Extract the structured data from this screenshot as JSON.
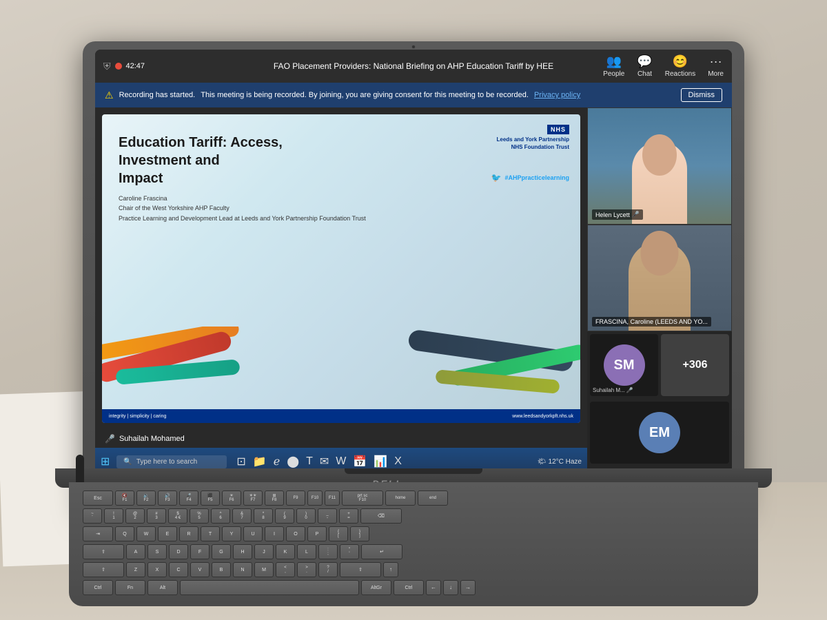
{
  "meeting": {
    "title": "FAO Placement Providers: National Briefing on AHP Education Tariff by HEE",
    "timer": "42:47",
    "recording_message": "Recording has started.",
    "recording_detail": "This meeting is being recorded. By joining, you are giving consent for this meeting to be recorded.",
    "privacy_link": "Privacy policy",
    "dismiss_label": "Dismiss"
  },
  "toolbar": {
    "people_label": "People",
    "chat_label": "Chat",
    "reactions_label": "Reactions",
    "more_label": "More"
  },
  "slide": {
    "nhs_logo": "NHS",
    "trust_name": "Leeds and York Partnership",
    "trust_sub": "NHS Foundation Trust",
    "title_line1": "Education Tariff: Access, Investment and",
    "title_line2": "Impact",
    "twitter_handle": "#AHPpracticelearning",
    "presenter_name": "Caroline Frascina",
    "presenter_role1": "Chair of the West Yorkshire AHP Faculty",
    "presenter_role2": "Practice Learning and Development Lead at Leeds and York Partnership Foundation Trust",
    "footer_text": "integrity  |  simplicity  |  caring",
    "footer_url": "www.leedsandyorkpft.nhs.uk"
  },
  "participants": {
    "helen": {
      "name": "Helen Lycett",
      "mic": true
    },
    "caroline": {
      "name": "FRASCINA, Caroline (LEEDS AND YO...",
      "mic": false
    },
    "suhailah": {
      "name": "Suhailah M...",
      "initials": "SM",
      "mic": true
    },
    "em": {
      "initials": "EM"
    },
    "count": "+306"
  },
  "presenter_bar": {
    "name": "Suhailah Mohamed",
    "mic_active": true
  },
  "taskbar": {
    "search_placeholder": "Type here to search",
    "weather": "12°C  Haze"
  },
  "keyboard": {
    "row1": [
      "Esc",
      "F1",
      "F2",
      "F3",
      "F4",
      "F5",
      "F6",
      "F7",
      "F8",
      "F9",
      "F10",
      "F11",
      "prt sc F10",
      "home",
      "end"
    ],
    "row2": [
      "~\n`",
      "!\n1",
      "@\n2",
      "#\n3",
      "$\n4 €",
      "%\n5",
      "^\n6",
      "&\n7",
      "*\n8",
      "(\n9",
      ")\n0",
      "_\n-",
      "+\n="
    ]
  }
}
